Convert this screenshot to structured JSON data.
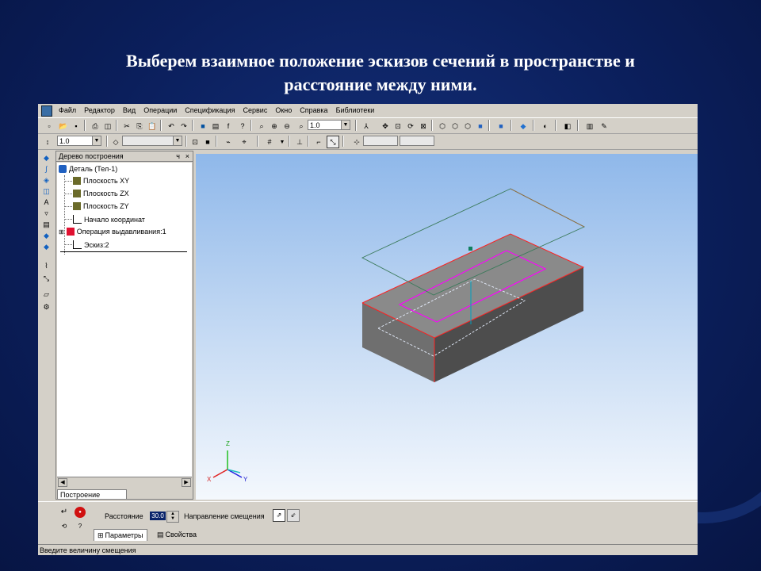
{
  "slide": {
    "title_line1": "Выберем взаимное положение эскизов сечений в пространстве и",
    "title_line2": "расстояние между ними."
  },
  "menubar": {
    "items": [
      "Файл",
      "Редактор",
      "Вид",
      "Операции",
      "Спецификация",
      "Сервис",
      "Окно",
      "Справка",
      "Библиотеки"
    ]
  },
  "toolbar1": {
    "scale_value": "1.0"
  },
  "toolbar2": {
    "step_value": "1.0"
  },
  "tree": {
    "header": "Дерево построения",
    "pin": "ч",
    "close": "×",
    "root": "Деталь (Тел-1)",
    "items": [
      "Плоскость XY",
      "Плоскость ZX",
      "Плоскость ZY",
      "Начало координат",
      "Операция выдавливания:1",
      "Эскиз:2"
    ],
    "tab_label": "Построение"
  },
  "properties": {
    "distance_label": "Расстояние",
    "distance_value": "30.0",
    "direction_label": "Направление смещения",
    "tab_params": "Параметры",
    "tab_props": "Свойства"
  },
  "status": {
    "text": "Введите величину смещения"
  },
  "axes": {
    "x": "X",
    "y": "Y",
    "z": "Z"
  },
  "colors": {
    "slide_bg": "#0b1f5c",
    "viewport_top": "#8fb8ea",
    "box_top": "#8c8c8c",
    "box_front": "#6e6e6e",
    "box_side": "#4a4a4a",
    "edge_red": "#ff2020",
    "sketch_magenta": "#ff00ff",
    "plane_green": "#3a8a5a"
  }
}
